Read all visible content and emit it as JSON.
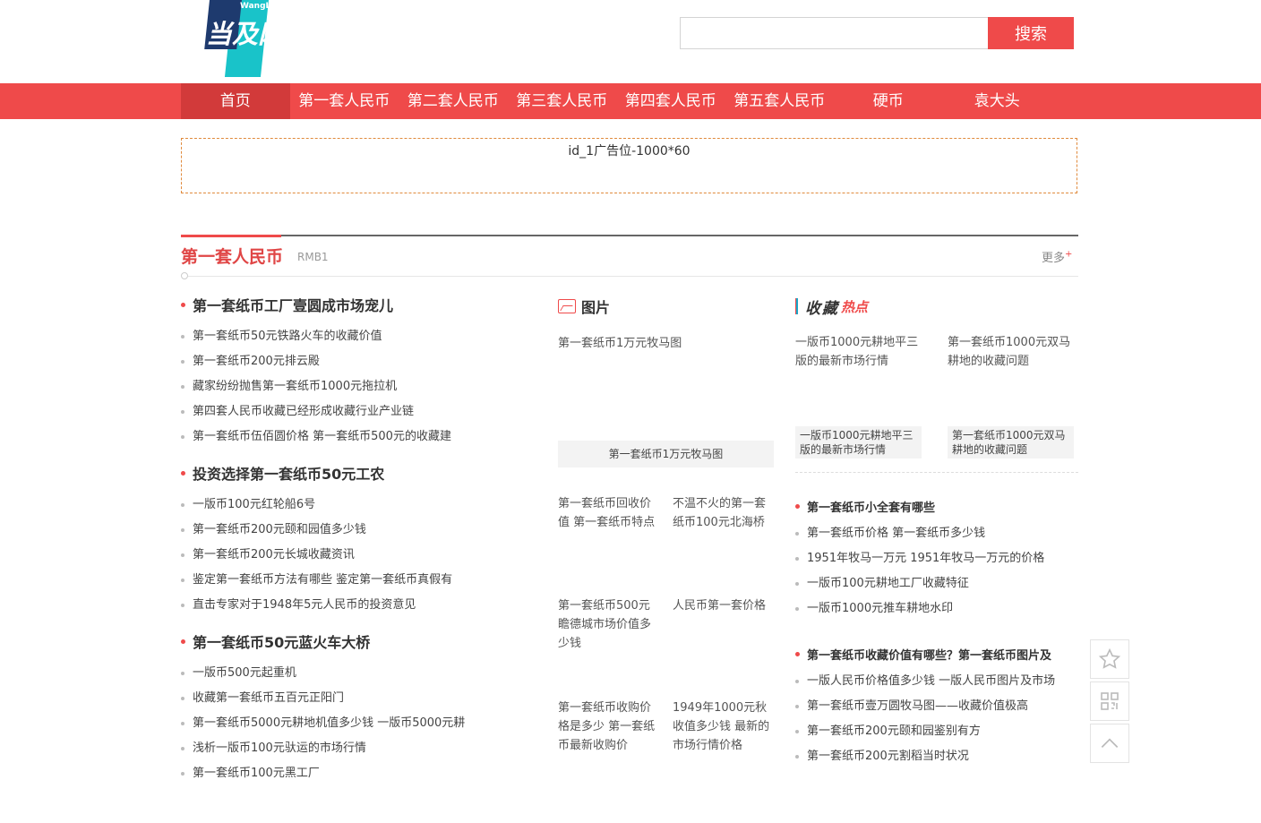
{
  "header": {
    "logo_text_main": "当及网络",
    "logo_text_sub": "WangLuo",
    "search_placeholder": "",
    "search_button": "搜索"
  },
  "nav": {
    "items": [
      {
        "label": "首页",
        "active": true
      },
      {
        "label": "第一套人民币"
      },
      {
        "label": "第二套人民币"
      },
      {
        "label": "第三套人民币"
      },
      {
        "label": "第四套人民币"
      },
      {
        "label": "第五套人民币"
      },
      {
        "label": "硬币"
      },
      {
        "label": "袁大头"
      }
    ]
  },
  "ad": {
    "text": "id_1广告位-1000*60"
  },
  "section": {
    "title": "第一套人民币",
    "subtitle": "RMB1",
    "more": "更多",
    "more_sup": "+"
  },
  "left_groups": [
    {
      "title": "第一套纸币工厂壹圆成市场宠儿",
      "items": [
        "第一套纸币50元铁路火车的收藏价值",
        "第一套纸币200元排云殿",
        "藏家纷纷抛售第一套纸币1000元拖拉机",
        "第四套人民币收藏已经形成收藏行业产业链",
        "第一套纸币伍佰圆价格 第一套纸币500元的收藏建"
      ]
    },
    {
      "title": "投资选择第一套纸币50元工农",
      "items": [
        "一版币100元红轮船6号",
        "第一套纸币200元颐和园值多少钱",
        "第一套纸币200元长城收藏资讯",
        "鉴定第一套纸币方法有哪些 鉴定第一套纸币真假有",
        "直击专家对于1948年5元人民币的投资意见"
      ]
    },
    {
      "title": "第一套纸币50元蓝火车大桥",
      "items": [
        "一版币500元起重机",
        "收藏第一套纸币五百元正阳门",
        "第一套纸币5000元耕地机值多少钱 一版币5000元耕",
        "浅析一版币100元驮运的市场行情",
        "第一套纸币100元黑工厂"
      ]
    }
  ],
  "middle": {
    "title": "图片",
    "big": {
      "alt": "第一套纸币1万元牧马图",
      "caption": "第一套纸币1万元牧马图"
    },
    "smalls": [
      "第一套纸币回收价值 第一套纸币特点",
      "不温不火的第一套纸币100元北海桥",
      "第一套纸币500元瞻德城市场价值多少钱",
      "人民币第一套价格",
      "第一套纸币收购价格是多少 第一套纸币最新收购价",
      "1949年1000元秋收值多少钱 最新的市场行情价格"
    ]
  },
  "right": {
    "title_main": "收藏",
    "title_hot": "热点",
    "pics": [
      {
        "alt": "一版币1000元耕地平三版的最新市场行情",
        "caption": "一版币1000元耕地平三版的最新市场行情"
      },
      {
        "alt": "第一套纸币1000元双马耕地的收藏问题",
        "caption": "第一套纸币1000元双马耕地的收藏问题"
      }
    ],
    "groups": [
      {
        "title": "第一套纸币小全套有哪些",
        "items": [
          "第一套纸币价格 第一套纸币多少钱",
          "1951年牧马一万元 1951年牧马一万元的价格",
          "一版币100元耕地工厂收藏特征",
          "一版币1000元推车耕地水印"
        ]
      },
      {
        "title": "第一套纸币收藏价值有哪些？第一套纸币图片及",
        "items": [
          "一版人民币价格值多少钱 一版人民币图片及市场",
          "第一套纸币壹万圆牧马图——收藏价值极高",
          "第一套纸币200元颐和园鉴别有方",
          "第一套纸币200元割稻当时状况"
        ]
      }
    ]
  },
  "side_tools": [
    "star-icon",
    "qrcode-icon",
    "back-to-top-icon"
  ],
  "colors": {
    "accent": "#ef4a4a",
    "nav_active": "#d23a3a",
    "logo_cyan": "#19c3c9",
    "logo_navy": "#1e3a6e"
  }
}
